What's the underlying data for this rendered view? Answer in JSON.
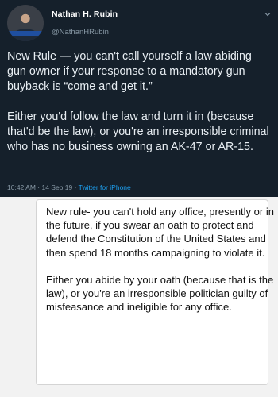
{
  "tweet": {
    "author_name": "Nathan H. Rubin",
    "author_handle": "@NathanHRubin",
    "paragraph1": "New Rule — you can't call yourself a law abiding gun owner if your response to a mandatory gun buyback is “come and get it.”",
    "paragraph2": "Either you'd follow the law and turn it in (because that'd be the law), or you're an irresponsible criminal who has no business owning an AK-47 or AR-15.",
    "timestamp": "10:42 AM · 14 Sep 19 · ",
    "source": "Twitter for iPhone",
    "menu_icon": "chevron-down-icon"
  },
  "reply": {
    "paragraph1": "New rule- you can't hold any office, presently or in the future, if you swear an oath to protect and defend the Constitution of the United States and then spend 18 months campaigning to violate it.",
    "paragraph2": "Either you abide by your oath (because that is the law), or you're an irresponsible politician guilty of misfeasance and ineligible for any office."
  },
  "colors": {
    "tweet_background": "#15202b",
    "secondary_text": "#8899a6",
    "link": "#1da1f2"
  }
}
